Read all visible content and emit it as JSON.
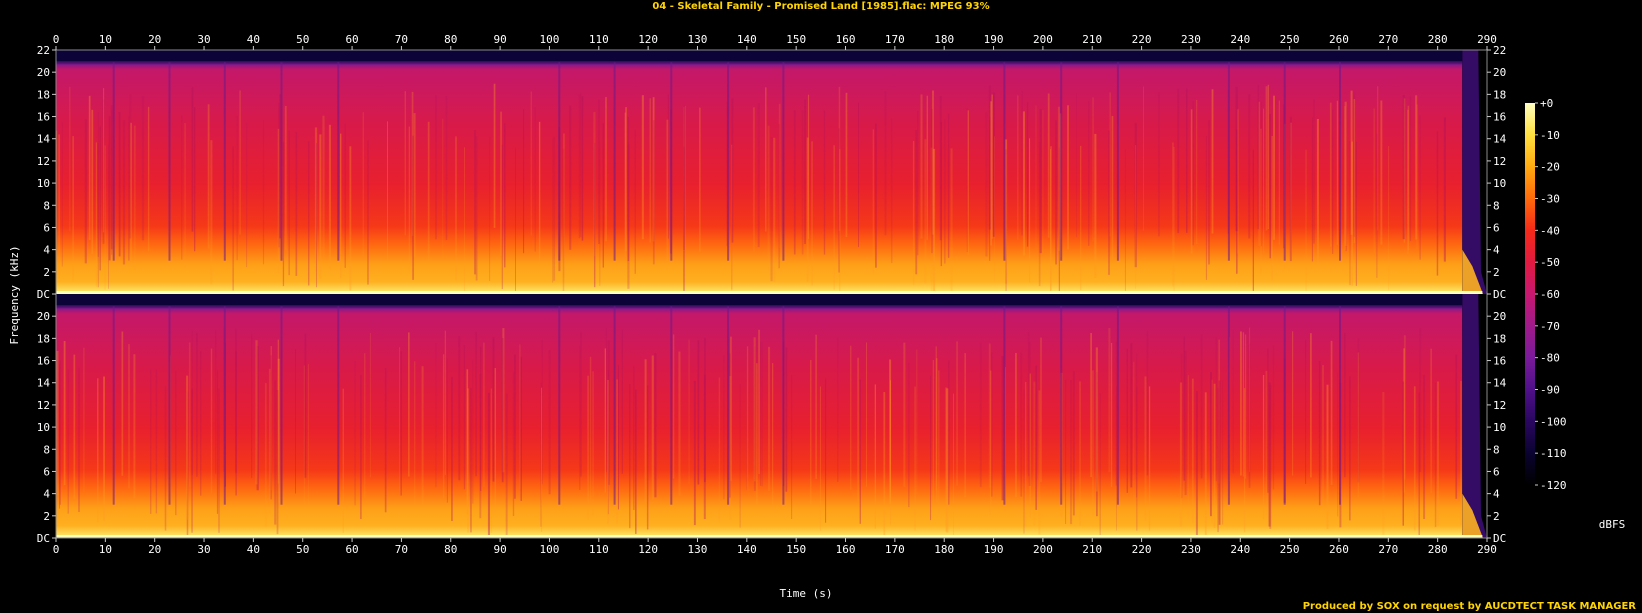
{
  "title": "04 - Skeletal Family - Promised Land [1985].flac: MPEG 93%",
  "footer": "Produced by SOX on request by AUCDTECT TASK MANAGER",
  "chart_data": {
    "type": "heatmap",
    "xlabel": "Time (s)",
    "ylabel": "Frequency (kHz)",
    "colorbar_label": "dBFS",
    "xlim": [
      0,
      290
    ],
    "ylim": [
      0,
      22
    ],
    "x_ticks": [
      0,
      10,
      20,
      30,
      40,
      50,
      60,
      70,
      80,
      90,
      100,
      110,
      120,
      130,
      140,
      150,
      160,
      170,
      180,
      190,
      200,
      210,
      220,
      230,
      240,
      250,
      260,
      270,
      280,
      290
    ],
    "y_ticks": [
      {
        "value": 0,
        "label": "DC"
      },
      {
        "value": 2,
        "label": "2"
      },
      {
        "value": 4,
        "label": "4"
      },
      {
        "value": 6,
        "label": "6"
      },
      {
        "value": 8,
        "label": "8"
      },
      {
        "value": 10,
        "label": "10"
      },
      {
        "value": 12,
        "label": "12"
      },
      {
        "value": 14,
        "label": "14"
      },
      {
        "value": 16,
        "label": "16"
      },
      {
        "value": 18,
        "label": "18"
      },
      {
        "value": 20,
        "label": "20"
      },
      {
        "value": 22,
        "label": "22"
      }
    ],
    "colorbar_ticks": [
      "+0",
      "-10",
      "-20",
      "-30",
      "-40",
      "-50",
      "-60",
      "-70",
      "-80",
      "-90",
      "-100",
      "-110",
      "-120"
    ],
    "colorbar_range": [
      -120,
      0
    ],
    "channels": 2,
    "cutoff_khz": 20.8,
    "track_end_s": 285,
    "colors": {
      "background": "#000000",
      "title": "#ffd400",
      "palette": [
        "#000000",
        "#0a0330",
        "#2a0660",
        "#50108a",
        "#7a1a9a",
        "#a01a8a",
        "#c81870",
        "#e21a40",
        "#f52a18",
        "#ff6a0a",
        "#ffaa10",
        "#ffe040",
        "#ffffc0"
      ]
    }
  }
}
